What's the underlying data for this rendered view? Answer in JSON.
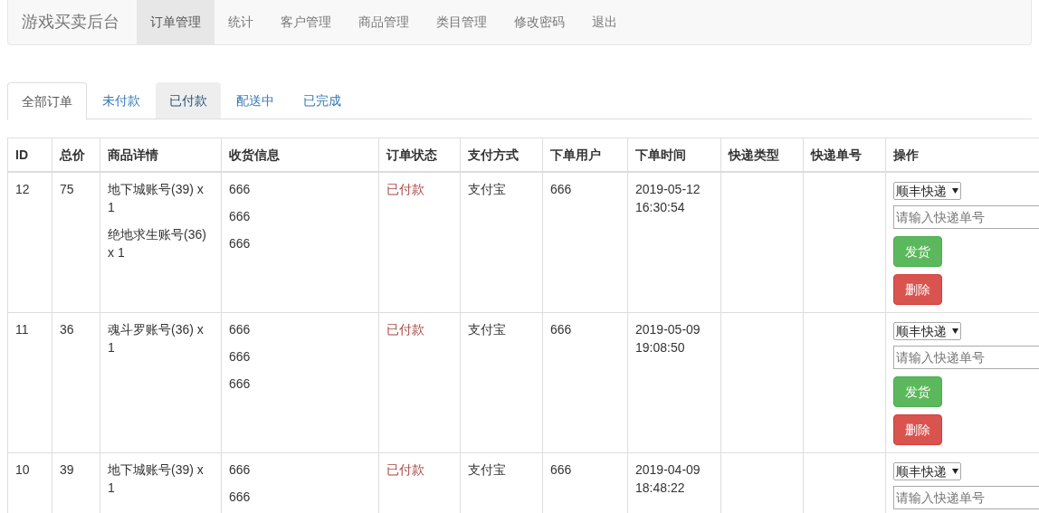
{
  "navbar": {
    "brand": "游戏买卖后台",
    "items": [
      {
        "label": "订单管理",
        "selected": true
      },
      {
        "label": "统计",
        "selected": false
      },
      {
        "label": "客户管理",
        "selected": false
      },
      {
        "label": "商品管理",
        "selected": false
      },
      {
        "label": "类目管理",
        "selected": false
      },
      {
        "label": "修改密码",
        "selected": false
      },
      {
        "label": "退出",
        "selected": false
      }
    ]
  },
  "tabs": [
    {
      "label": "全部订单",
      "selected": true,
      "highlighted": false
    },
    {
      "label": "未付款",
      "selected": false,
      "highlighted": false
    },
    {
      "label": "已付款",
      "selected": false,
      "highlighted": true
    },
    {
      "label": "配送中",
      "selected": false,
      "highlighted": false
    },
    {
      "label": "已完成",
      "selected": false,
      "highlighted": false
    }
  ],
  "table": {
    "columns": [
      "ID",
      "总价",
      "商品详情",
      "收货信息",
      "订单状态",
      "支付方式",
      "下单用户",
      "下单时间",
      "快递类型",
      "快递单号",
      "操作"
    ],
    "rows": [
      {
        "id": "12",
        "total": "75",
        "products": [
          "地下城账号(39) x 1",
          "绝地求生账号(36) x 1"
        ],
        "shipping": [
          "666",
          "666",
          "666"
        ],
        "status": "已付款",
        "payment": "支付宝",
        "user": "666",
        "time": "2019-05-12 16:30:54",
        "courier_select": "顺丰快递",
        "tracking_placeholder": "请输入快递单号",
        "buttons": [
          {
            "label": "发货",
            "kind": "success"
          },
          {
            "label": "删除",
            "kind": "danger"
          }
        ]
      },
      {
        "id": "11",
        "total": "36",
        "products": [
          "魂斗罗账号(36) x 1"
        ],
        "shipping": [
          "666",
          "666",
          "666"
        ],
        "status": "已付款",
        "payment": "支付宝",
        "user": "666",
        "time": "2019-05-09 19:08:50",
        "courier_select": "顺丰快递",
        "tracking_placeholder": "请输入快递单号",
        "buttons": [
          {
            "label": "发货",
            "kind": "success"
          },
          {
            "label": "删除",
            "kind": "danger"
          }
        ]
      },
      {
        "id": "10",
        "total": "39",
        "products": [
          "地下城账号(39) x 1"
        ],
        "shipping": [
          "666",
          "666"
        ],
        "status": "已付款",
        "payment": "支付宝",
        "user": "666",
        "time": "2019-04-09 18:48:22",
        "courier_select": "顺丰快递",
        "tracking_placeholder": "请输入快递单号"
      }
    ]
  }
}
